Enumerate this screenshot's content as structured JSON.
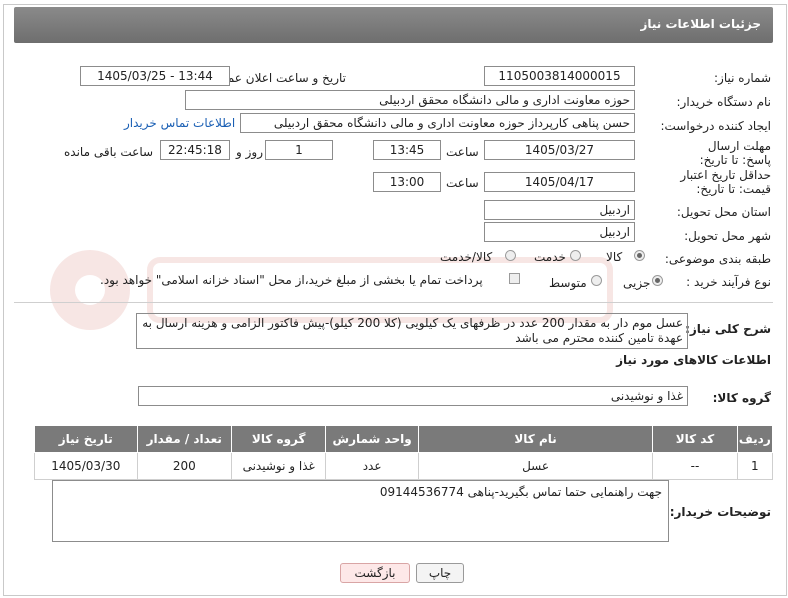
{
  "header": {
    "title": "جزئیات اطلاعات نیاز"
  },
  "fields": {
    "need_number_label": "شماره نیاز:",
    "need_number": "1105003814000015",
    "announce_label": "تاریخ و ساعت اعلان عمومی:",
    "announce_value": "1405/03/25 - 13:44",
    "buyer_label": "نام دستگاه خریدار:",
    "buyer_value": "حوزه معاونت اداری و مالی دانشگاه محقق اردبیلی",
    "creator_label": "ایجاد کننده درخواست:",
    "creator_value": "حسن پناهی کارپرداز حوزه معاونت اداری و مالی دانشگاه محقق اردبیلی",
    "contact_link": "اطلاعات تماس خریدار",
    "reply_deadline_label": "مهلت ارسال پاسخ: تا تاریخ:",
    "reply_date": "1405/03/27",
    "time_word": "ساعت",
    "reply_time": "13:45",
    "days": "1",
    "day_and": "روز و",
    "remaining": "22:45:18",
    "remaining_label": "ساعت باقی مانده",
    "price_deadline_label": "حداقل تاریخ اعتبار قیمت: تا تاریخ:",
    "price_date": "1405/04/17",
    "price_time": "13:00",
    "province_label": "استان محل تحویل:",
    "province_value": "اردبیل",
    "city_label": "شهر محل تحویل:",
    "city_value": "اردبیل",
    "category_label": "طبقه بندی موضوعی:",
    "category_options": [
      "کالا",
      "خدمت",
      "کالا/خدمت"
    ],
    "process_label": "نوع فرآیند خرید :",
    "process_options": [
      "جزیی",
      "متوسط"
    ],
    "payment_note": "پرداخت تمام یا بخشی از مبلغ خرید،از محل \"اسناد خزانه اسلامی\" خواهد بود."
  },
  "description": {
    "label": "شرح کلی نیاز:",
    "text": "عسل موم دار به مقدار 200 عدد در ظرفهای یک کیلویی (کلا 200 کیلو)-پیش فاکتور الزامی و هزینه ارسال به عهدة تامین کننده محترم می باشد"
  },
  "goods": {
    "section_title": "اطلاعات کالاهای مورد نیاز",
    "group_label": "گروه کالا:",
    "group_value": "غذا و نوشیدنی",
    "columns": [
      "ردیف",
      "کد کالا",
      "نام کالا",
      "واحد شمارش",
      "گروه کالا",
      "تعداد / مقدار",
      "تاریخ نیاز"
    ],
    "rows": [
      [
        "1",
        "--",
        "عسل",
        "عدد",
        "غذا و نوشیدنی",
        "200",
        "1405/03/30"
      ]
    ]
  },
  "buyer_notes": {
    "label": "توضیحات خریدار:",
    "text": "جهت راهنمایی حتما تماس بگیرید-پناهی 09144536774"
  },
  "buttons": {
    "print": "چاپ",
    "back": "بازگشت"
  },
  "colors": {
    "titlebar": "#7a7a7a",
    "link": "#1a5fb4",
    "back_button": "#fde8e8"
  }
}
